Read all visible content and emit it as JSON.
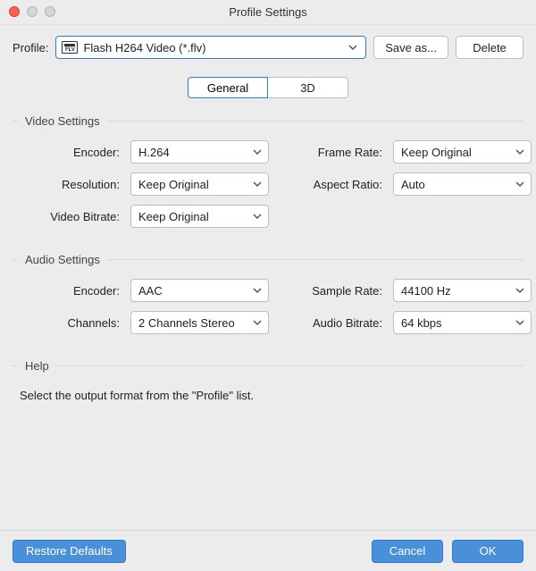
{
  "window": {
    "title": "Profile Settings"
  },
  "profile": {
    "label": "Profile:",
    "selected": "Flash H264 Video (*.flv)",
    "icon_text": "FLV",
    "save_as": "Save as...",
    "delete": "Delete"
  },
  "tabs": {
    "general": "General",
    "threeD": "3D",
    "active": "general"
  },
  "video": {
    "title": "Video Settings",
    "encoder_label": "Encoder:",
    "encoder": "H.264",
    "resolution_label": "Resolution:",
    "resolution": "Keep Original",
    "bitrate_label": "Video Bitrate:",
    "bitrate": "Keep Original",
    "frame_rate_label": "Frame Rate:",
    "frame_rate": "Keep Original",
    "aspect_ratio_label": "Aspect Ratio:",
    "aspect_ratio": "Auto"
  },
  "audio": {
    "title": "Audio Settings",
    "encoder_label": "Encoder:",
    "encoder": "AAC",
    "channels_label": "Channels:",
    "channels": "2 Channels Stereo",
    "sample_rate_label": "Sample Rate:",
    "sample_rate": "44100 Hz",
    "bitrate_label": "Audio Bitrate:",
    "bitrate": "64 kbps"
  },
  "help": {
    "title": "Help",
    "text": "Select the output format from the \"Profile\" list."
  },
  "footer": {
    "restore": "Restore Defaults",
    "cancel": "Cancel",
    "ok": "OK"
  }
}
